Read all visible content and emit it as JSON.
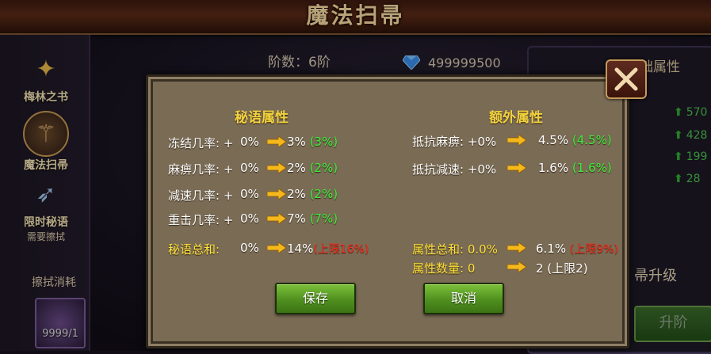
{
  "header": {
    "title": "魔法扫帚"
  },
  "sidebar": {
    "items": [
      {
        "label": "梅林之书",
        "sub": ""
      },
      {
        "label": "魔法扫帚",
        "sub": ""
      },
      {
        "label": "限时秘语",
        "sub": "需要擦拭"
      }
    ],
    "cost_label": "擦拭消耗",
    "cost_count": "9999/1"
  },
  "main": {
    "stage": "阶数：6阶",
    "gems": "499999500"
  },
  "right_panel": {
    "header": "基础属性",
    "stats": [
      "570",
      "428",
      "199",
      "28"
    ],
    "upgrade_title": "帚升级",
    "upgrade_button": "升阶"
  },
  "dialog": {
    "mystic": {
      "title": "秘语属性",
      "rows": [
        {
          "label": "冻结几率: +",
          "cur": "0%",
          "next": "3%",
          "note": "(3%)"
        },
        {
          "label": "麻痹几率: +",
          "cur": "0%",
          "next": "2%",
          "note": "(2%)"
        },
        {
          "label": "减速几率: +",
          "cur": "0%",
          "next": "2%",
          "note": "(2%)"
        },
        {
          "label": "重击几率: +",
          "cur": "0%",
          "next": "7%",
          "note": "(7%)"
        }
      ],
      "total": {
        "label": "秘语总和:",
        "cur": "0%",
        "next": "14%",
        "note": "(上限16%)"
      }
    },
    "extra": {
      "title": "额外属性",
      "rows": [
        {
          "label": "抵抗麻痹: +0%",
          "next": "4.5%",
          "note": "(4.5%)"
        },
        {
          "label": "抵抗减速: +0%",
          "next": "1.6%",
          "note": "(1.6%)"
        }
      ],
      "total": {
        "label": "属性总和: 0.0%",
        "next": "6.1%",
        "note": "(上限9%)"
      },
      "count": {
        "label": "属性数量: 0",
        "next": "2 (上限2)"
      }
    },
    "save_button": "保存",
    "cancel_button": "取消"
  },
  "colors": {
    "gold_title": "#f3d23e",
    "green_note": "#3df03a",
    "red_note": "#ff2a1a",
    "dialog_bg": "#7a6b55"
  }
}
